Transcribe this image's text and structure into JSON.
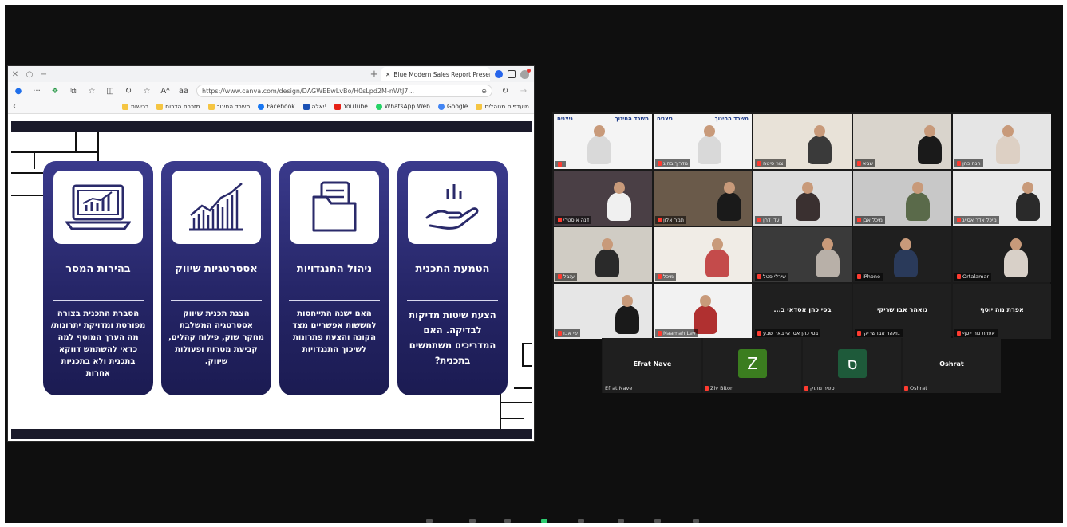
{
  "browser": {
    "tab_title": "Blue Modern Sales Report Presen",
    "url": "https://www.canva.com/design/DAGWEEwLvBo/H0sLpd2M-nWtJ7...",
    "text_size_label": "Aᴬ",
    "reader_label": "aa",
    "bookmarks": [
      {
        "label": "מועדפים מנוהלים",
        "icon": "folder"
      },
      {
        "label": "Google",
        "icon": "g"
      },
      {
        "label": "WhatsApp Web",
        "icon": "wa"
      },
      {
        "label": "YouTube",
        "icon": "yt"
      },
      {
        "label": "יאלה!",
        "icon": "yl"
      },
      {
        "label": "Facebook",
        "icon": "fb"
      },
      {
        "label": "משרד החינוך",
        "icon": "folder"
      },
      {
        "label": "מזכרת הדרום",
        "icon": "folder"
      },
      {
        "label": "רכישות",
        "icon": "folder"
      }
    ]
  },
  "slide": {
    "cards": [
      {
        "title": "הטמעת התכנית",
        "body": "הצעת שיטות מדיקות לבדיקה. האם המדריכים משתמשים בתכנית?",
        "icon": "hand-icon"
      },
      {
        "title": "ניהול התנגדויות",
        "body": "האם ישנה התייחסות לחששות אפשריים מצד הקונה והצעת פתרונות לשיכוך התנגדויות",
        "icon": "folder-icon"
      },
      {
        "title": "אסטרטגיות שיווק",
        "body": "הצגת תכנית שיווק אסטרטגיה המשלבת מחקר שוק, פילוח קהלים, קביעת מטרות ופעולות שיווק.",
        "icon": "chart-icon"
      },
      {
        "title": "בהירות המסר",
        "body": "הסברת התכנית בצורה מפורטת ומדויקת יתרונות/ מה הערך המוסף למה כדאי להשתמש דווקא בתכנית ולא בתכניות אחרות",
        "icon": "laptop-chart-icon"
      }
    ]
  },
  "gallery": {
    "logo_text_1": "ניצנים",
    "logo_text_2": "משרד החינוך",
    "tiles": [
      {
        "name": "",
        "scene": "logo"
      },
      {
        "name": "מדריך בחוג",
        "scene": "logo"
      },
      {
        "name": "צור סיטה",
        "scene": "office"
      },
      {
        "name": "שגיא",
        "scene": "office2"
      },
      {
        "name": "חנה כהן",
        "scene": "office3"
      },
      {
        "name": "דנה אוסטרי",
        "scene": "room"
      },
      {
        "name": "תמר אלון",
        "scene": "room2"
      },
      {
        "name": "עדי דהן",
        "scene": "room3"
      },
      {
        "name": "מיכל אבן",
        "scene": "room4"
      },
      {
        "name": "מיכל אדר אסייג",
        "scene": "room5"
      },
      {
        "name": "ענבל",
        "scene": "room6"
      },
      {
        "name": "מיכל",
        "scene": "room7"
      },
      {
        "name": "שירלי פטל",
        "scene": "room8"
      },
      {
        "name": "iPhone",
        "scene": "room9"
      },
      {
        "name": "Ortalamar",
        "scene": "room10"
      },
      {
        "name": "שי אבו",
        "scene": "room11"
      },
      {
        "name": "Naamah Lev",
        "scene": "room12"
      },
      {
        "name": "בסי כהן אסדאי ב...",
        "scene": "namecard",
        "tag": "בסי כהן אסדאי באר שבע"
      },
      {
        "name": "גואהר אבו שריקי",
        "scene": "namecard",
        "tag": "גואהר אבו שריקי"
      },
      {
        "name": "אפרת נוה יוסף",
        "scene": "namecard",
        "tag": "אפרת נוה יוסף"
      }
    ],
    "bottom": [
      {
        "name": "Efrat Nave",
        "tag": "Efrat Nave",
        "letter": ""
      },
      {
        "name": "",
        "tag": "Ziv Biton",
        "letter": "Z",
        "color": "#3b7d1f"
      },
      {
        "name": "",
        "tag": "ספיר מתוק",
        "letter": "ס",
        "color": "#1e5a3a"
      },
      {
        "name": "Oshrat",
        "tag": "Oshrat",
        "letter": ""
      }
    ]
  }
}
